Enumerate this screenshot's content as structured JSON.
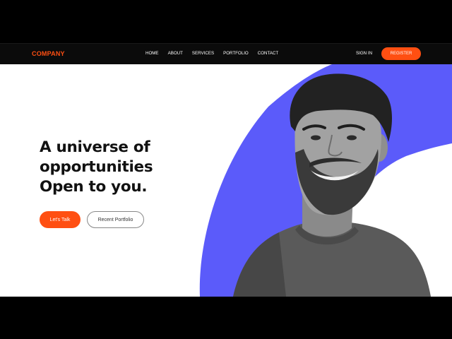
{
  "colors": {
    "accent": "#ff4f12",
    "blue": "#5b5bfa",
    "hero_bg": "#ffffff",
    "nav_bg": "#0b0b0b"
  },
  "nav": {
    "logo": "COMPANY",
    "links": [
      "HOME",
      "ABOUT",
      "SERVICES",
      "PORTFOLIO",
      "CONTACT"
    ],
    "signin": "SIGN IN",
    "register": "REGISTER"
  },
  "hero": {
    "headline_lines": [
      "A universe of",
      "opportunities",
      "Open to you."
    ],
    "primary_button": "Let's Talk",
    "secondary_button": "Recent Portfolio",
    "image": "grayscale-smiling-man-photo"
  }
}
